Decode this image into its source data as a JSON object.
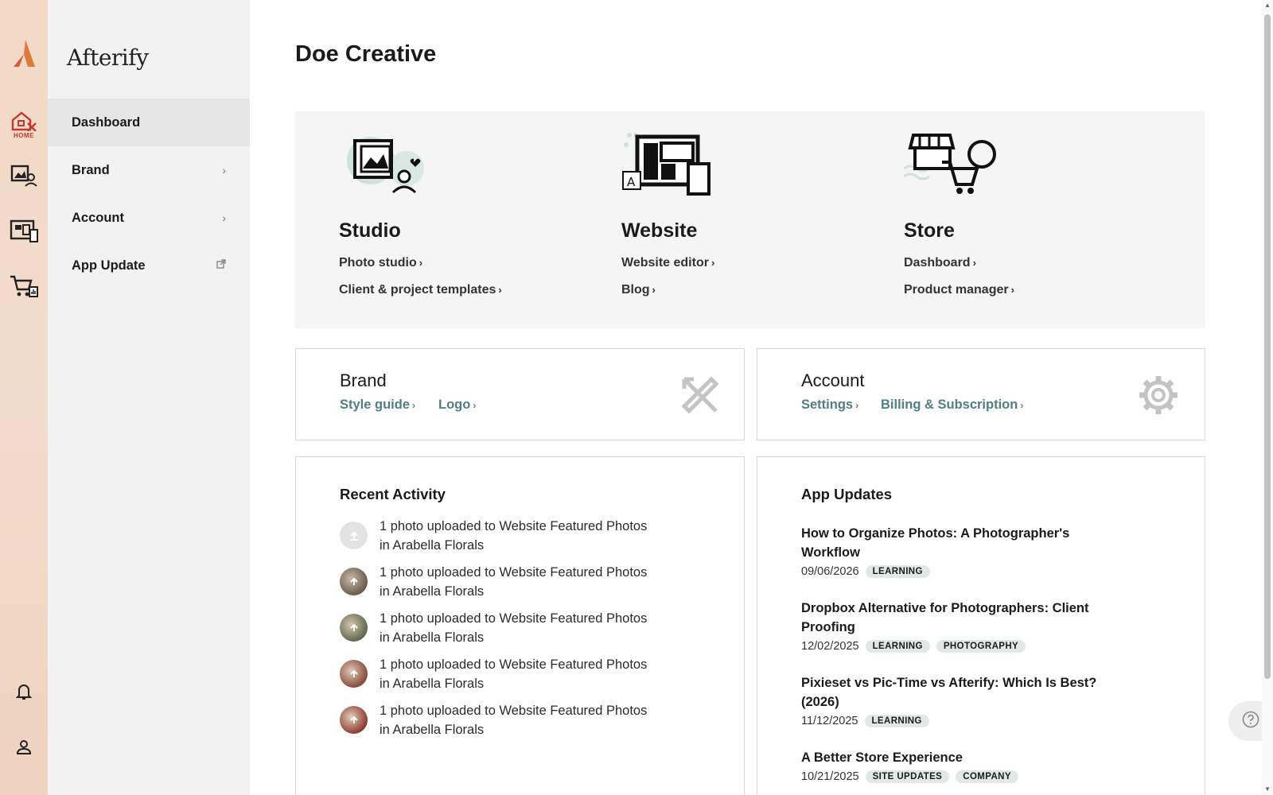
{
  "rail": {
    "home_label": "HOME"
  },
  "sidebar": {
    "brand": "Afterify",
    "items": [
      {
        "label": "Dashboard",
        "icon": "none"
      },
      {
        "label": "Brand",
        "icon": "chevron-right-icon"
      },
      {
        "label": "Account",
        "icon": "chevron-right-icon"
      },
      {
        "label": "App Update",
        "icon": "external-link-icon"
      }
    ]
  },
  "page": {
    "title": "Doe Creative"
  },
  "hero": {
    "studio": {
      "title": "Studio",
      "links": [
        "Photo studio",
        "Client & project templates"
      ]
    },
    "website": {
      "title": "Website",
      "links": [
        "Website editor",
        "Blog"
      ]
    },
    "store": {
      "title": "Store",
      "links": [
        "Dashboard",
        "Product manager"
      ]
    }
  },
  "brand_card": {
    "title": "Brand",
    "links": [
      "Style guide",
      "Logo"
    ]
  },
  "account_card": {
    "title": "Account",
    "links": [
      "Settings",
      "Billing & Subscription"
    ]
  },
  "recent_activity": {
    "title": "Recent Activity",
    "items": [
      {
        "line1": "1 photo uploaded to Website Featured Photos",
        "line2": "in Arabella Florals"
      },
      {
        "line1": "1 photo uploaded to Website Featured Photos",
        "line2": "in Arabella Florals"
      },
      {
        "line1": "1 photo uploaded to Website Featured Photos",
        "line2": "in Arabella Florals"
      },
      {
        "line1": "1 photo uploaded to Website Featured Photos",
        "line2": "in Arabella Florals"
      },
      {
        "line1": "1 photo uploaded to Website Featured Photos",
        "line2": "in Arabella Florals"
      }
    ]
  },
  "app_updates": {
    "title": "App Updates",
    "items": [
      {
        "title": "How to Organize Photos: A Photographer's Workflow",
        "date": "09/06/2026",
        "tags": [
          "LEARNING"
        ]
      },
      {
        "title": "Dropbox Alternative for Photographers: Client Proofing",
        "date": "12/02/2025",
        "tags": [
          "LEARNING",
          "PHOTOGRAPHY"
        ]
      },
      {
        "title": "Pixieset vs Pic-Time vs Afterify: Which Is Best? (2026)",
        "date": "11/12/2025",
        "tags": [
          "LEARNING"
        ]
      },
      {
        "title": "A Better Store Experience",
        "date": "10/21/2025",
        "tags": [
          "SITE UPDATES",
          "COMPANY"
        ]
      }
    ]
  },
  "colors": {
    "accent": "#d9573a",
    "link_teal": "#4f7f85",
    "tag_bg": "#e2e8e8"
  }
}
